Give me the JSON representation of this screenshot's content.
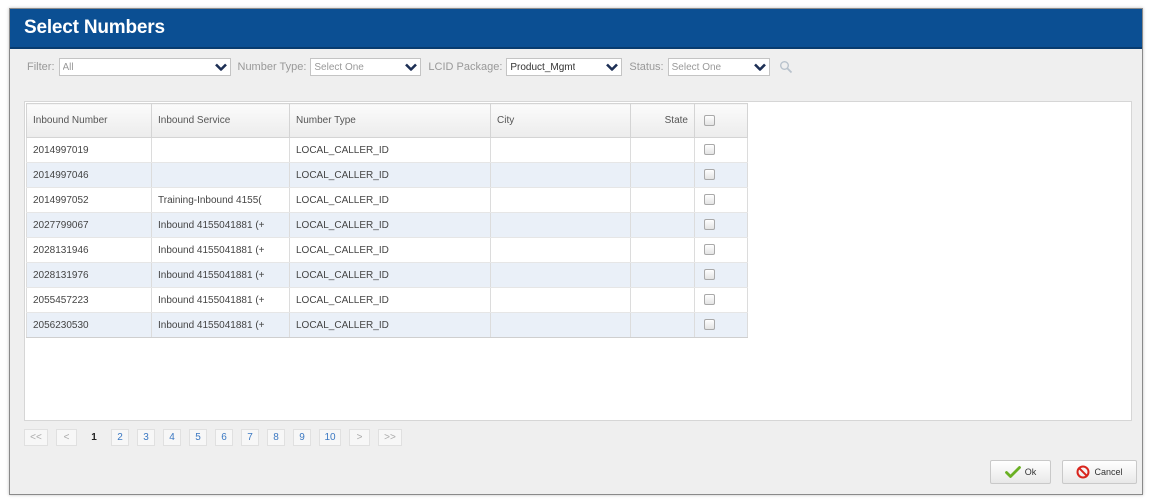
{
  "dialog": {
    "title": "Select Numbers"
  },
  "filters": {
    "filter_label": "Filter:",
    "filter_value": "All",
    "number_type_label": "Number Type:",
    "number_type_value": "Select One",
    "lcid_label": "LCID Package:",
    "lcid_value": "Product_Mgmt",
    "status_label": "Status:",
    "status_value": "Select One"
  },
  "table": {
    "headers": {
      "inbound_number": "Inbound Number",
      "inbound_service": "Inbound Service",
      "number_type": "Number Type",
      "city": "City",
      "state": "State"
    },
    "rows": [
      {
        "number": "2014997019",
        "service": "",
        "type": "LOCAL_CALLER_ID",
        "city": "",
        "state": ""
      },
      {
        "number": "2014997046",
        "service": "",
        "type": "LOCAL_CALLER_ID",
        "city": "",
        "state": ""
      },
      {
        "number": "2014997052",
        "service": "Training-Inbound 4155(",
        "type": "LOCAL_CALLER_ID",
        "city": "",
        "state": ""
      },
      {
        "number": "2027799067",
        "service": "Inbound 4155041881 (+",
        "type": "LOCAL_CALLER_ID",
        "city": "",
        "state": ""
      },
      {
        "number": "2028131946",
        "service": "Inbound 4155041881 (+",
        "type": "LOCAL_CALLER_ID",
        "city": "",
        "state": ""
      },
      {
        "number": "2028131976",
        "service": "Inbound 4155041881 (+",
        "type": "LOCAL_CALLER_ID",
        "city": "",
        "state": ""
      },
      {
        "number": "2055457223",
        "service": "Inbound 4155041881 (+",
        "type": "LOCAL_CALLER_ID",
        "city": "",
        "state": ""
      },
      {
        "number": "2056230530",
        "service": "Inbound 4155041881 (+",
        "type": "LOCAL_CALLER_ID",
        "city": "",
        "state": ""
      }
    ]
  },
  "pagination": {
    "first": "<<",
    "prev": "<",
    "pages": [
      "1",
      "2",
      "3",
      "4",
      "5",
      "6",
      "7",
      "8",
      "9",
      "10"
    ],
    "current": "1",
    "next": ">",
    "last": ">>"
  },
  "buttons": {
    "ok": "Ok",
    "cancel": "Cancel"
  },
  "colors": {
    "title_bar": "#0b4f93",
    "alt_row": "#eaf0f8",
    "ok_check": "#6ab023",
    "cancel_red": "#d9251d",
    "page_link": "#3b78c2"
  },
  "icons": {
    "search": "search-icon",
    "dropdown": "chevron-down-icon",
    "ok": "checkmark-icon",
    "cancel": "no-entry-icon"
  }
}
